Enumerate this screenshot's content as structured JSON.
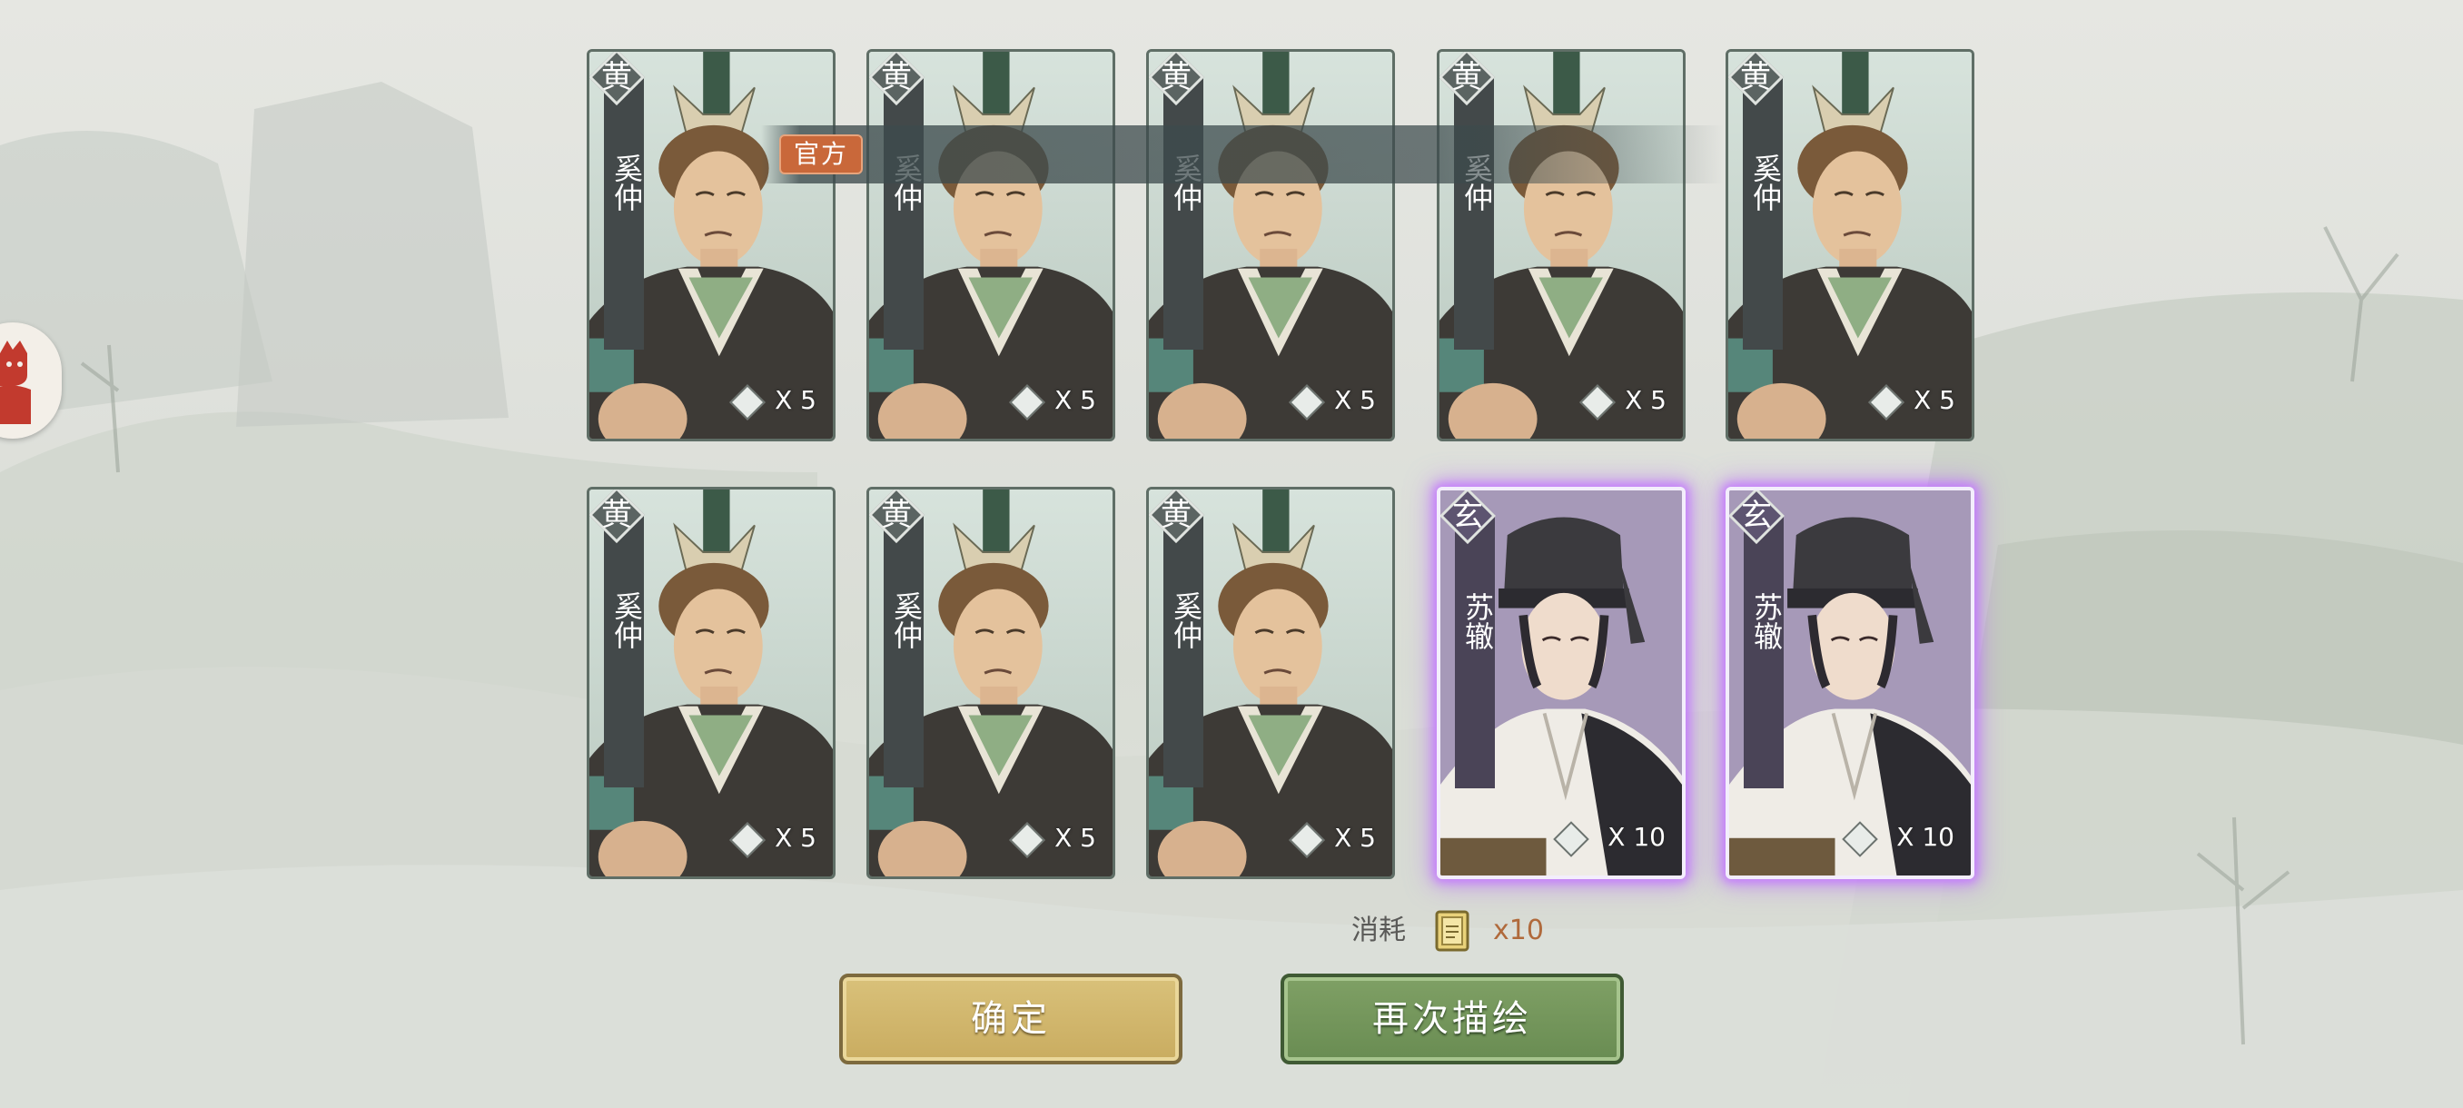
{
  "banner": {
    "tag": "官方"
  },
  "cards": [
    {
      "grade": "黄",
      "name": "奚仲",
      "count": "X 5",
      "rarity": "yellow"
    },
    {
      "grade": "黄",
      "name": "奚仲",
      "count": "X 5",
      "rarity": "yellow"
    },
    {
      "grade": "黄",
      "name": "奚仲",
      "count": "X 5",
      "rarity": "yellow"
    },
    {
      "grade": "黄",
      "name": "奚仲",
      "count": "X 5",
      "rarity": "yellow"
    },
    {
      "grade": "黄",
      "name": "奚仲",
      "count": "X 5",
      "rarity": "yellow"
    },
    {
      "grade": "黄",
      "name": "奚仲",
      "count": "X 5",
      "rarity": "yellow"
    },
    {
      "grade": "黄",
      "name": "奚仲",
      "count": "X 5",
      "rarity": "yellow"
    },
    {
      "grade": "黄",
      "name": "奚仲",
      "count": "X 5",
      "rarity": "yellow"
    },
    {
      "grade": "玄",
      "name": "苏辙",
      "count": "X 10",
      "rarity": "purple"
    },
    {
      "grade": "玄",
      "name": "苏辙",
      "count": "X 10",
      "rarity": "purple"
    }
  ],
  "cost": {
    "label": "消耗",
    "value": "x10",
    "icon": "scroll-ticket-icon"
  },
  "buttons": {
    "confirm": "确定",
    "again": "再次描绘"
  },
  "side_badge": {
    "icon": "red-mascot-icon"
  },
  "colors": {
    "confirm": "#c9ac60",
    "again": "#698c52",
    "purple_glow": "#c478ff",
    "official_tag": "#c9683a"
  }
}
